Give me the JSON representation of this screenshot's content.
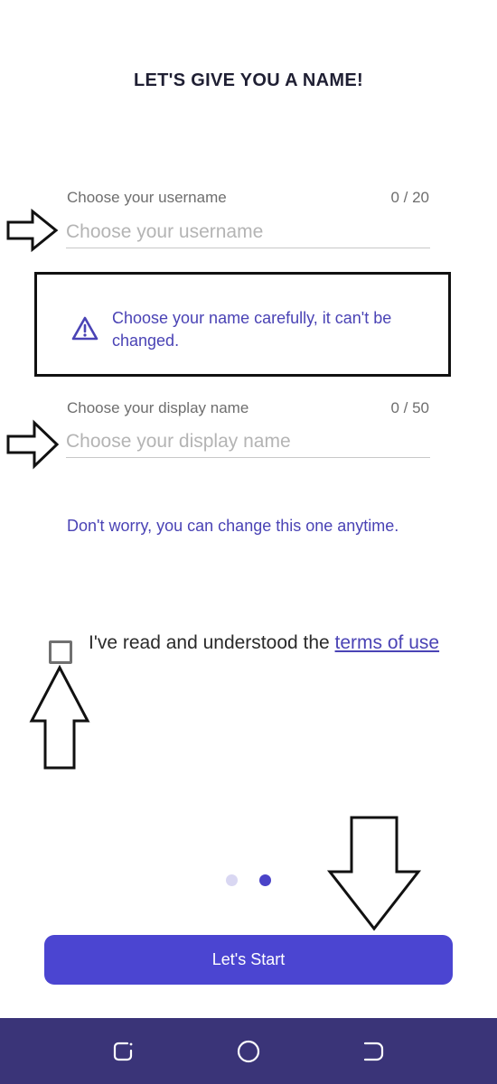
{
  "header": {
    "title": "LET'S GIVE YOU A NAME!"
  },
  "username": {
    "label": "Choose your username",
    "counter": "0 / 20",
    "placeholder": "Choose your username",
    "value": ""
  },
  "warning": {
    "icon": "warning-triangle-icon",
    "text": "Choose your name carefully, it can't be changed."
  },
  "display_name": {
    "label": "Choose your display name",
    "counter": "0 / 50",
    "placeholder": "Choose your display name",
    "value": "",
    "hint": "Don't worry, you can change this one anytime."
  },
  "terms": {
    "checked": false,
    "prefix": "I've read and understood the ",
    "link_text": "terms of use"
  },
  "pager": {
    "total": 2,
    "active": 2
  },
  "footer": {
    "start_label": "Let's Start"
  },
  "navigation": {
    "buttons": [
      "recent-apps-icon",
      "home-icon",
      "back-icon"
    ]
  },
  "colors": {
    "accent": "#4b45d1",
    "accent_text": "#4a43b5",
    "nav_bar": "#3a3478",
    "inactive_dot": "#d9d7f2"
  }
}
